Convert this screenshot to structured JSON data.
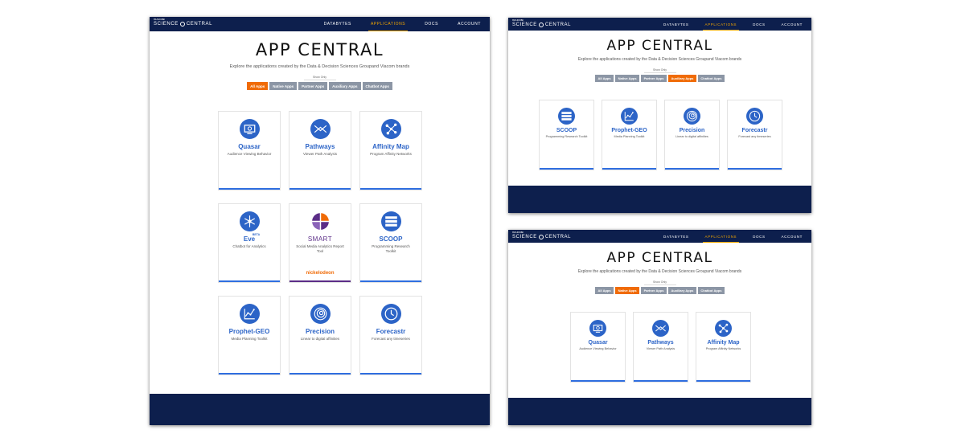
{
  "brand": {
    "top": "VIACOM",
    "main_left": "SCIENCE",
    "main_right": "CENTRAL"
  },
  "nav": {
    "databytes": "DATABYTES",
    "applications": "APPLICATIONS",
    "docs": "DOCS",
    "account": "ACCOUNT"
  },
  "page": {
    "title": "APP CENTRAL",
    "subtitle": "Explore the applications created by the Data & Decision Sciences Groupand Viacom brands",
    "show_only": "Show Only"
  },
  "filters": {
    "all": "All Apps",
    "native": "Native Apps",
    "partner": "Partner Apps",
    "auxiliary": "Auxiliary Apps",
    "chatbot": "Chatbot Apps"
  },
  "apps": {
    "quasar": {
      "name": "Quasar",
      "desc": "Audience Viewing Behavior"
    },
    "pathways": {
      "name": "Pathways",
      "desc": "Viewer Path Analysis"
    },
    "affinity": {
      "name": "Affinity Map",
      "desc": "Program Affinity Networks"
    },
    "eve": {
      "name": "Eve",
      "badge": "BETA",
      "desc": "Chatbot for Analytics"
    },
    "smart": {
      "name": "SMART",
      "desc": "Social Media Analytics Report Tool",
      "brand": "nickelodeon"
    },
    "scoop": {
      "name": "SCOOP",
      "desc": "Programming Research Toolkit"
    },
    "prophet": {
      "name": "Prophet-GEO",
      "desc": "Media Planning Toolkit"
    },
    "precision": {
      "name": "Precision",
      "desc": "Linear to digital affinities"
    },
    "forecastr": {
      "name": "Forecastr",
      "desc": "Forecast any timeseries"
    }
  },
  "colors": {
    "navy": "#0d1f4d",
    "accent_orange": "#f06b07",
    "nav_active": "#f0a500",
    "app_blue": "#2c64c7",
    "smart_purple": "#5b2d87"
  },
  "icons": [
    "monitor-icon",
    "pathways-icon",
    "network-icon",
    "snowflake-icon",
    "smart-logo-icon",
    "server-stack-icon",
    "line-chart-icon",
    "precision-swirl-icon",
    "clock-icon"
  ]
}
